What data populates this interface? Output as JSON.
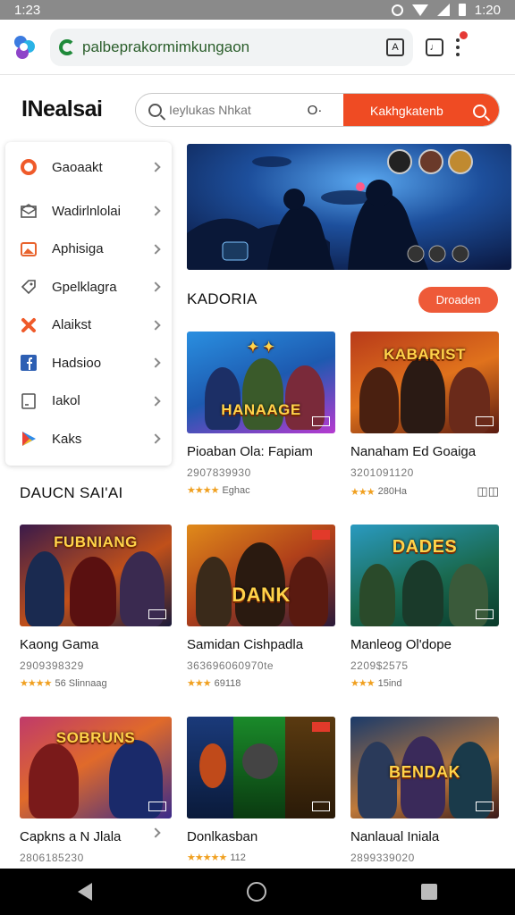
{
  "status_bar": {
    "time_left": "1:23",
    "time_right": "1:20"
  },
  "browser": {
    "url": "palbeprakormimkungaon"
  },
  "header": {
    "brand": "INealsai",
    "search": {
      "placeholder": "Ieylukas Nhkat",
      "filter_label": "O·",
      "button_label": "Kakhgkatenb"
    }
  },
  "sidebar": {
    "items": [
      {
        "label": "Gaoaakt",
        "icon": "orange-ring-icon"
      },
      {
        "label": "Wadirlnlolai",
        "icon": "envelope-icon"
      },
      {
        "label": "Aphisiga",
        "icon": "image-icon"
      },
      {
        "label": "Gpelklagra",
        "icon": "tag-icon"
      },
      {
        "label": "Alaikst",
        "icon": "cross-ribbon-icon"
      },
      {
        "label": "Hadsioo",
        "icon": "facebook-icon"
      },
      {
        "label": "Iakol",
        "icon": "document-icon"
      },
      {
        "label": "Kaks",
        "icon": "play-icon"
      }
    ]
  },
  "sections": {
    "category_title": "KADORIA",
    "category_button": "Droaden",
    "popular_title": "DAUCN SAI'AI"
  },
  "games": [
    {
      "title": "Pioaban Ola: Fapiam",
      "meta": "2907839930",
      "rating": "Eghac",
      "logo": "HANAAGE",
      "stars": "★★★★"
    },
    {
      "title": "Nanaham Ed Goaiga",
      "meta": "3201091120",
      "rating": "280Ha",
      "logo": "KABARIST",
      "stars": "★★★"
    },
    {
      "title": "Kaong Gama",
      "meta": "2909398329",
      "rating": "56 Slinnaag",
      "logo": "FUBNIANG",
      "stars": "★★★★"
    },
    {
      "title": "Samidan Cishpadla",
      "meta": "363696060970te",
      "rating": "69118",
      "logo": "DANK",
      "stars": "★★★"
    },
    {
      "title": "Manleog Ol'dope",
      "meta": "2209$2575",
      "rating": "15ind",
      "logo": "DADES",
      "stars": "★★★"
    },
    {
      "title": "Capkns a N Jlala",
      "meta": "2806185230",
      "rating": "",
      "logo": "SOBRUNS",
      "stars": "★★★"
    },
    {
      "title": "Donlkasban",
      "meta": "",
      "rating": "112",
      "logo": "",
      "stars": "★★★★★"
    },
    {
      "title": "Nanlaual Iniala",
      "meta": "2899339020",
      "rating": "",
      "logo": "BENDAK",
      "stars": "★★★"
    }
  ],
  "colors": {
    "accent": "#ef4b23",
    "pill": "#ee5a38",
    "star": "#f0a020"
  }
}
